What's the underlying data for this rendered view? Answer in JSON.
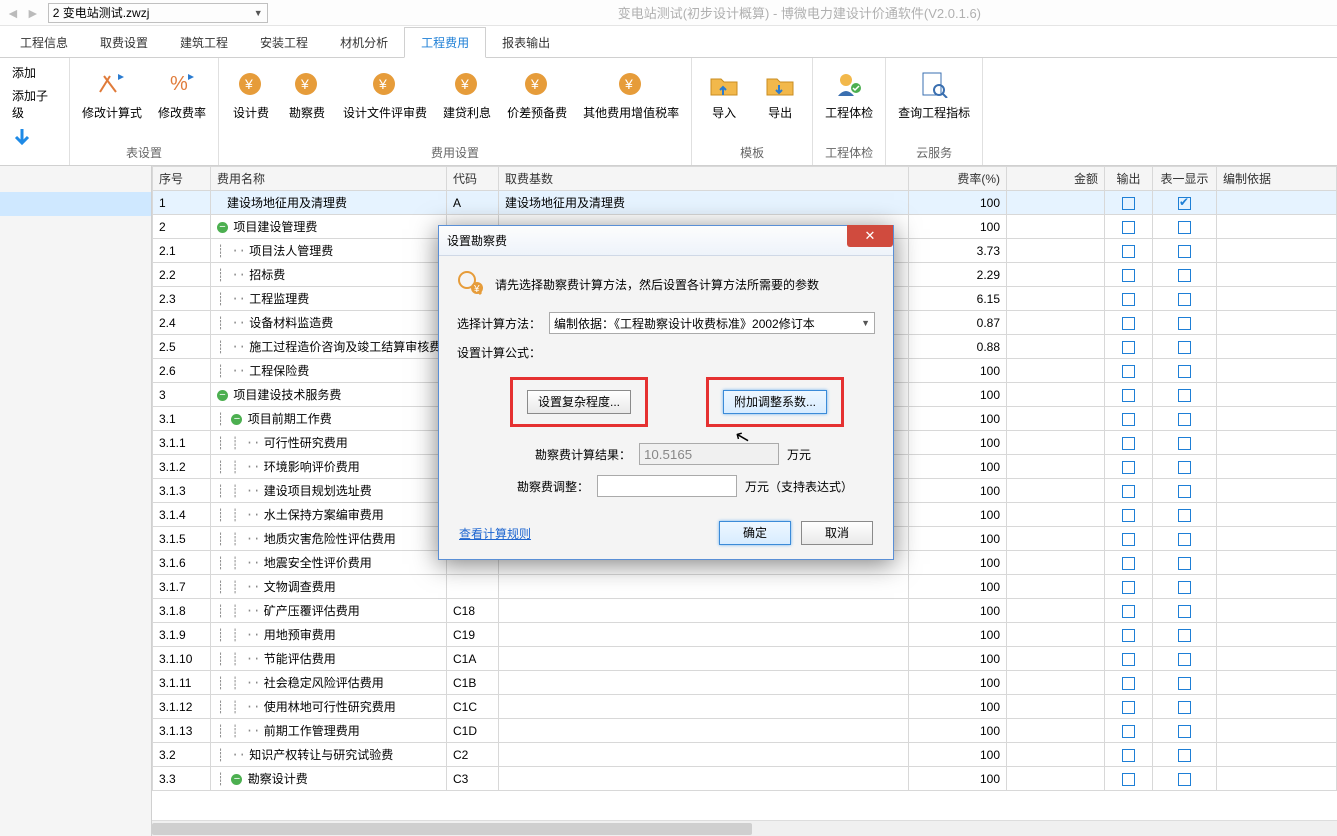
{
  "app": {
    "file": "2 变电站测试.zwzj",
    "title": "变电站测试(初步设计概算) - 博微电力建设计价通软件(V2.0.1.6)"
  },
  "menu": {
    "tabs": [
      "工程信息",
      "取费设置",
      "建筑工程",
      "安装工程",
      "材机分析",
      "工程费用",
      "报表输出"
    ],
    "active": 5
  },
  "ribbon": {
    "groups": [
      {
        "label": "",
        "items": [
          {
            "t": "添加"
          },
          {
            "t": "添加子级"
          }
        ]
      },
      {
        "label": "表设置",
        "items": [
          {
            "t": "修改计算式"
          },
          {
            "t": "修改费率"
          }
        ]
      },
      {
        "label": "费用设置",
        "items": [
          {
            "t": "设计费"
          },
          {
            "t": "勘察费"
          },
          {
            "t": "设计文件评审费"
          },
          {
            "t": "建贷利息"
          },
          {
            "t": "价差预备费"
          },
          {
            "t": "其他费用增值税率"
          }
        ]
      },
      {
        "label": "模板",
        "items": [
          {
            "t": "导入"
          },
          {
            "t": "导出"
          }
        ]
      },
      {
        "label": "工程体检",
        "items": [
          {
            "t": "工程体检"
          }
        ]
      },
      {
        "label": "云服务",
        "items": [
          {
            "t": "查询工程指标"
          }
        ]
      }
    ]
  },
  "columns": [
    "序号",
    "费用名称",
    "代码",
    "取费基数",
    "费率(%)",
    "金额",
    "输出",
    "表一显示",
    "编制依据"
  ],
  "rows": [
    {
      "seq": "1",
      "name": "建设场地征用及清理费",
      "ind": 0,
      "exp": "",
      "code": "A",
      "basis": "建设场地征用及清理费",
      "rate": "100",
      "out": false,
      "show": true
    },
    {
      "seq": "2",
      "name": "项目建设管理费",
      "ind": 0,
      "exp": "minus",
      "code": "",
      "basis": "",
      "rate": "100",
      "out": false,
      "show": false
    },
    {
      "seq": "2.1",
      "name": "项目法人管理费",
      "ind": 1,
      "exp": "",
      "code": "",
      "basis": "",
      "rate": "3.73",
      "out": false,
      "show": false
    },
    {
      "seq": "2.2",
      "name": "招标费",
      "ind": 1,
      "exp": "",
      "code": "",
      "basis": "",
      "rate": "2.29",
      "out": false,
      "show": false
    },
    {
      "seq": "2.3",
      "name": "工程监理费",
      "ind": 1,
      "exp": "",
      "code": "",
      "basis": "",
      "rate": "6.15",
      "out": false,
      "show": false
    },
    {
      "seq": "2.4",
      "name": "设备材料监造费",
      "ind": 1,
      "exp": "",
      "code": "",
      "basis": "",
      "rate": "0.87",
      "out": false,
      "show": false
    },
    {
      "seq": "2.5",
      "name": "施工过程造价咨询及竣工结算审核费",
      "ind": 1,
      "exp": "",
      "code": "",
      "basis": "",
      "rate": "0.88",
      "out": false,
      "show": false
    },
    {
      "seq": "2.6",
      "name": "工程保险费",
      "ind": 1,
      "exp": "",
      "code": "",
      "basis": "",
      "rate": "100",
      "out": false,
      "show": false
    },
    {
      "seq": "3",
      "name": "项目建设技术服务费",
      "ind": 0,
      "exp": "minus",
      "code": "",
      "basis": "",
      "rate": "100",
      "out": false,
      "show": false
    },
    {
      "seq": "3.1",
      "name": "项目前期工作费",
      "ind": 1,
      "exp": "minus",
      "code": "",
      "basis": "",
      "rate": "100",
      "out": false,
      "show": false
    },
    {
      "seq": "3.1.1",
      "name": "可行性研究费用",
      "ind": 2,
      "exp": "",
      "code": "",
      "basis": "",
      "rate": "100",
      "out": false,
      "show": false
    },
    {
      "seq": "3.1.2",
      "name": "环境影响评价费用",
      "ind": 2,
      "exp": "",
      "code": "",
      "basis": "",
      "rate": "100",
      "out": false,
      "show": false
    },
    {
      "seq": "3.1.3",
      "name": "建设项目规划选址费",
      "ind": 2,
      "exp": "",
      "code": "",
      "basis": "",
      "rate": "100",
      "out": false,
      "show": false
    },
    {
      "seq": "3.1.4",
      "name": "水土保持方案编审费用",
      "ind": 2,
      "exp": "",
      "code": "",
      "basis": "",
      "rate": "100",
      "out": false,
      "show": false
    },
    {
      "seq": "3.1.5",
      "name": "地质灾害危险性评估费用",
      "ind": 2,
      "exp": "",
      "code": "",
      "basis": "",
      "rate": "100",
      "out": false,
      "show": false
    },
    {
      "seq": "3.1.6",
      "name": "地震安全性评价费用",
      "ind": 2,
      "exp": "",
      "code": "",
      "basis": "",
      "rate": "100",
      "out": false,
      "show": false
    },
    {
      "seq": "3.1.7",
      "name": "文物调查费用",
      "ind": 2,
      "exp": "",
      "code": "",
      "basis": "",
      "rate": "100",
      "out": false,
      "show": false
    },
    {
      "seq": "3.1.8",
      "name": "矿产压覆评估费用",
      "ind": 2,
      "exp": "",
      "code": "C18",
      "basis": "",
      "rate": "100",
      "out": false,
      "show": false
    },
    {
      "seq": "3.1.9",
      "name": "用地预审费用",
      "ind": 2,
      "exp": "",
      "code": "C19",
      "basis": "",
      "rate": "100",
      "out": false,
      "show": false
    },
    {
      "seq": "3.1.10",
      "name": "节能评估费用",
      "ind": 2,
      "exp": "",
      "code": "C1A",
      "basis": "",
      "rate": "100",
      "out": false,
      "show": false
    },
    {
      "seq": "3.1.11",
      "name": "社会稳定风险评估费用",
      "ind": 2,
      "exp": "",
      "code": "C1B",
      "basis": "",
      "rate": "100",
      "out": false,
      "show": false
    },
    {
      "seq": "3.1.12",
      "name": "使用林地可行性研究费用",
      "ind": 2,
      "exp": "",
      "code": "C1C",
      "basis": "",
      "rate": "100",
      "out": false,
      "show": false
    },
    {
      "seq": "3.1.13",
      "name": "前期工作管理费用",
      "ind": 2,
      "exp": "",
      "code": "C1D",
      "basis": "",
      "rate": "100",
      "out": false,
      "show": false
    },
    {
      "seq": "3.2",
      "name": "知识产权转让与研究试验费",
      "ind": 1,
      "exp": "",
      "code": "C2",
      "basis": "",
      "rate": "100",
      "out": false,
      "show": false
    },
    {
      "seq": "3.3",
      "name": "勘察设计费",
      "ind": 1,
      "exp": "minus",
      "code": "C3",
      "basis": "",
      "rate": "100",
      "out": false,
      "show": false
    }
  ],
  "dialog": {
    "title": "设置勘察费",
    "hint": "请先选择勘察费计算方法，然后设置各计算方法所需要的参数",
    "method_label": "选择计算方法：",
    "method_value": "编制依据：《工程勘察设计收费标准》2002修订本",
    "formula_label": "设置计算公式：",
    "btn1": "设置复杂程度...",
    "btn2": "附加调整系数...",
    "result_label": "勘察费计算结果：",
    "result_value": "10.5165",
    "result_unit": "万元",
    "adjust_label": "勘察费调整：",
    "adjust_unit": "万元（支持表达式）",
    "link": "查看计算规则",
    "ok": "确定",
    "cancel": "取消"
  }
}
